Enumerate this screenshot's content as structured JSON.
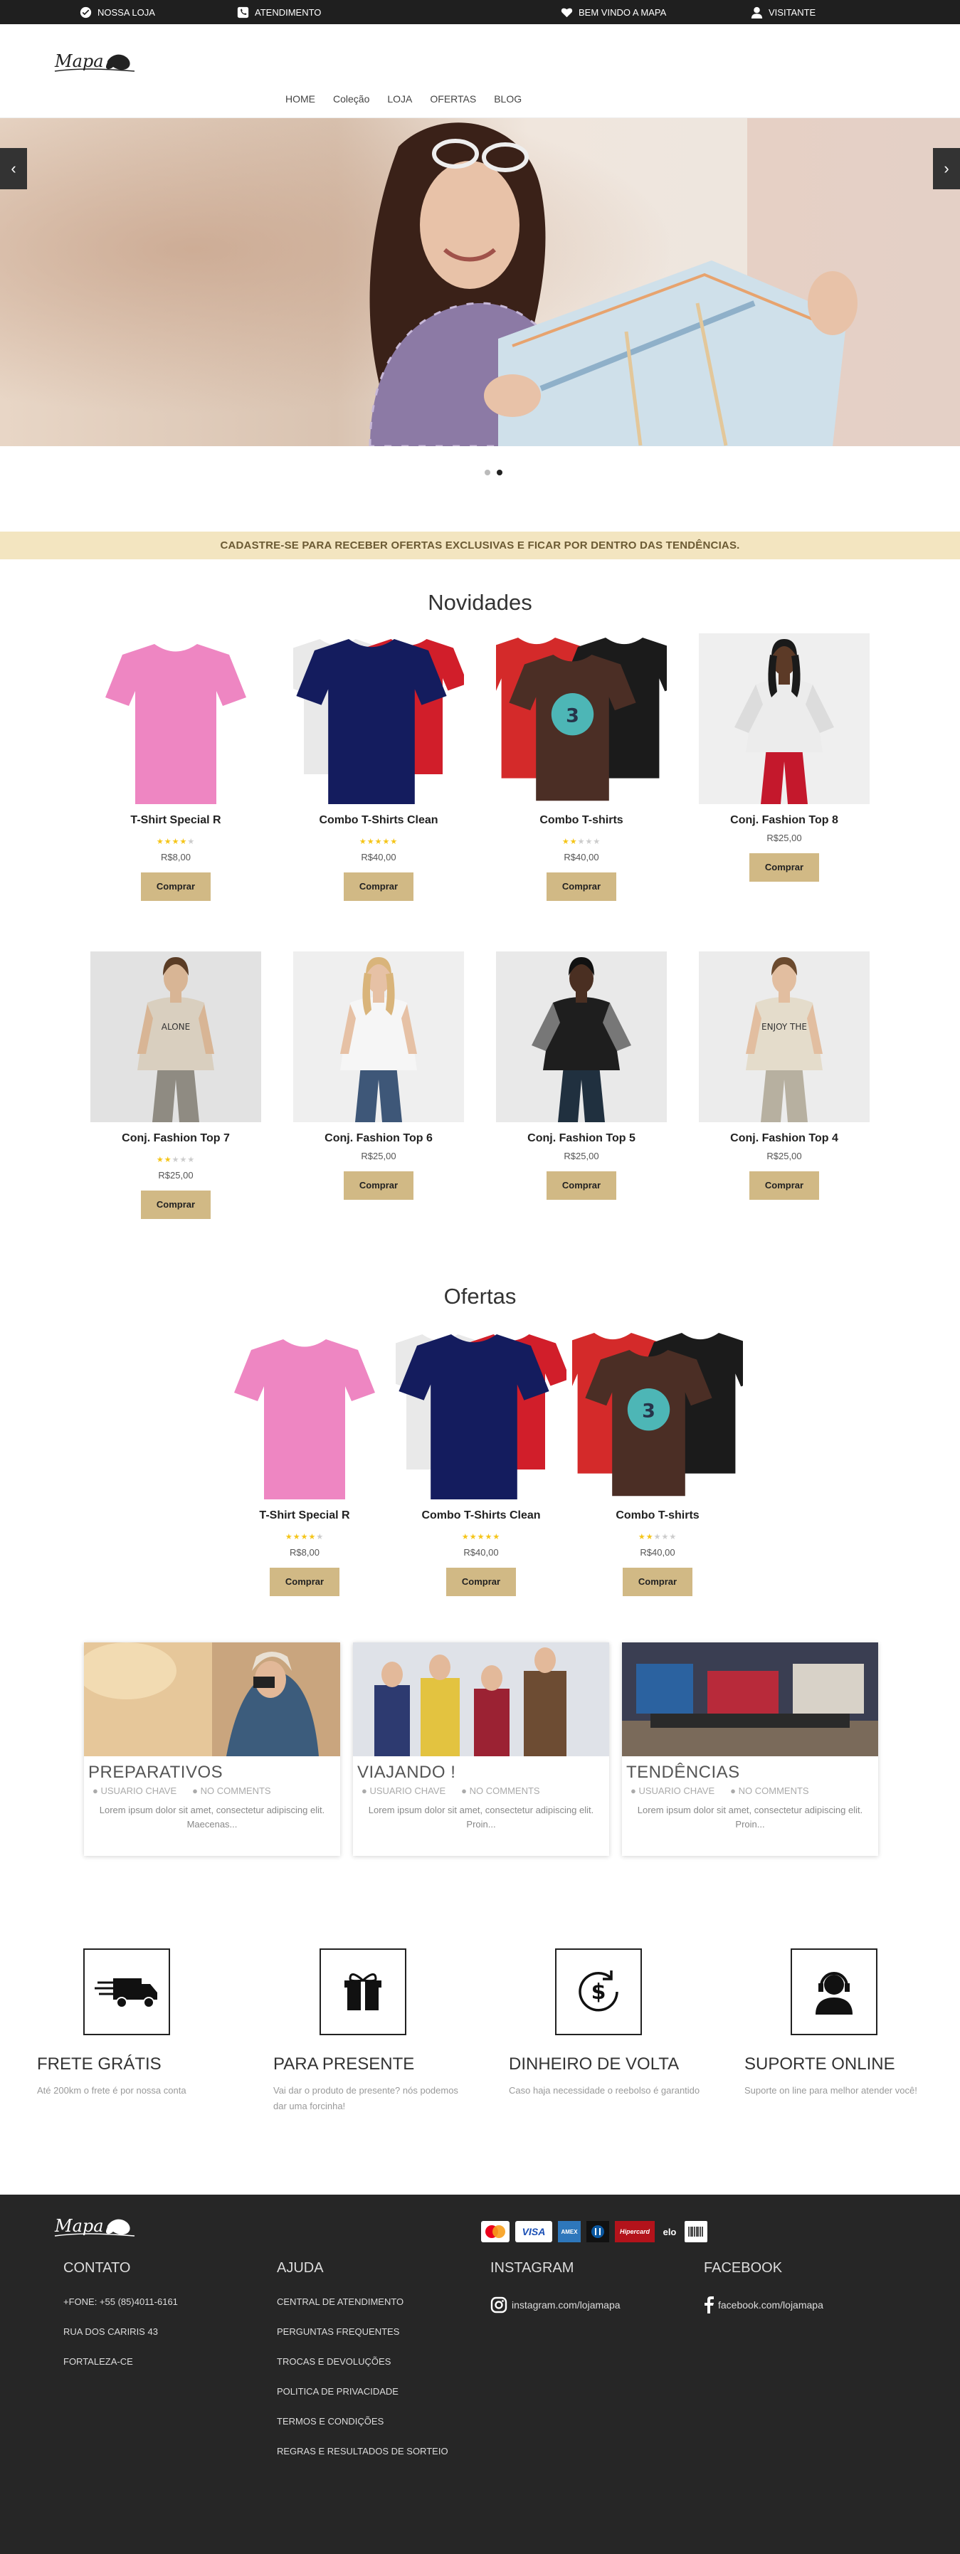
{
  "topbar": {
    "store": "NOSSA LOJA",
    "service": "ATENDIMENTO",
    "welcome": "BEM VINDO A MAPA",
    "visitor": "VISITANTE"
  },
  "brand": {
    "logo_text": "Mapa"
  },
  "nav": [
    "HOME",
    "Coleção",
    "LOJA",
    "OFERTAS",
    "BLOG"
  ],
  "hero": {
    "prev": "‹",
    "next": "›"
  },
  "newsletter": "CADASTRE-SE PARA RECEBER OFERTAS EXCLUSIVAS E FICAR POR DENTRO DAS TENDÊNCIAS.",
  "novidades": {
    "title": "Novidades",
    "buy_label": "Comprar",
    "products": [
      {
        "name": "T-Shirt Special R",
        "price": "R$8,00",
        "rating": 4,
        "img": "pink-tee"
      },
      {
        "name": "Combo T-Shirts Clean",
        "price": "R$40,00",
        "rating": 5,
        "img": "combo-clean"
      },
      {
        "name": "Combo T-shirts",
        "price": "R$40,00",
        "rating": 2,
        "img": "combo-print"
      },
      {
        "name": "Conj. Fashion Top 8",
        "price": "R$25,00",
        "rating": 0,
        "img": "fashion-8"
      },
      {
        "name": "Conj. Fashion Top 7",
        "price": "R$25,00",
        "rating": 2,
        "img": "fashion-7"
      },
      {
        "name": "Conj. Fashion Top 6",
        "price": "R$25,00",
        "rating": 0,
        "img": "fashion-6"
      },
      {
        "name": "Conj. Fashion Top 5",
        "price": "R$25,00",
        "rating": 0,
        "img": "fashion-5"
      },
      {
        "name": "Conj. Fashion Top 4",
        "price": "R$25,00",
        "rating": 0,
        "img": "fashion-4"
      }
    ]
  },
  "ofertas": {
    "title": "Ofertas",
    "buy_label": "Comprar",
    "products": [
      {
        "name": "T-Shirt Special R",
        "price": "R$8,00",
        "rating": 4,
        "img": "pink-tee"
      },
      {
        "name": "Combo T-Shirts Clean",
        "price": "R$40,00",
        "rating": 5,
        "img": "combo-clean"
      },
      {
        "name": "Combo T-shirts",
        "price": "R$40,00",
        "rating": 2,
        "img": "combo-print"
      }
    ]
  },
  "blog": [
    {
      "title": "PREPARATIVOS",
      "author": "USUARIO CHAVE",
      "comments": "NO COMMENTS",
      "excerpt": "Lorem ipsum dolor sit amet, consectetur adipiscing elit. Maecenas..."
    },
    {
      "title": "VIAJANDO !",
      "author": "USUARIO CHAVE",
      "comments": "NO COMMENTS",
      "excerpt": "Lorem ipsum dolor sit amet, consectetur adipiscing elit. Proin..."
    },
    {
      "title": "TENDÊNCIAS",
      "author": "USUARIO CHAVE",
      "comments": "NO COMMENTS",
      "excerpt": "Lorem ipsum dolor sit amet, consectetur adipiscing elit. Proin..."
    }
  ],
  "features": [
    {
      "title": "FRETE GRÁTIS",
      "text": "Até 200km o frete é por nossa conta",
      "icon": "truck-icon"
    },
    {
      "title": "PARA PRESENTE",
      "text": "Vai dar o produto de presente? nós podemos dar uma forcinha!",
      "icon": "gift-icon"
    },
    {
      "title": "DINHEIRO DE VOLTA",
      "text": "Caso haja necessidade o reebolso é garantido",
      "icon": "money-back-icon"
    },
    {
      "title": "SUPORTE ONLINE",
      "text": "Suporte on line para melhor atender você!",
      "icon": "support-icon"
    }
  ],
  "footer": {
    "contato": {
      "title": "CONTATO",
      "items": [
        "+FONE: +55 (85)4011-6161",
        "RUA DOS CARIRIS 43",
        "FORTALEZA-CE"
      ]
    },
    "ajuda": {
      "title": "AJUDA",
      "items": [
        "CENTRAL DE ATENDIMENTO",
        "PERGUNTAS FREQUENTES",
        "TROCAS E DEVOLUÇÕES",
        "POLITICA DE PRIVACIDADE",
        "TERMOS E CONDIÇÕES",
        "REGRAS E RESULTADOS DE SORTEIO"
      ]
    },
    "instagram": {
      "title": "INSTAGRAM",
      "link": "instagram.com/lojamapa"
    },
    "facebook": {
      "title": "FACEBOOK",
      "link": "facebook.com/lojamapa"
    },
    "payments": [
      "MasterCard",
      "VISA",
      "AMEX",
      "Diners",
      "Hipercard",
      "elo",
      "Boleto"
    ]
  },
  "colors": {
    "accent": "#d1b985",
    "band": "#f3e5c0",
    "footer_bg": "#262626",
    "topbar_bg": "#1f1f1f"
  }
}
